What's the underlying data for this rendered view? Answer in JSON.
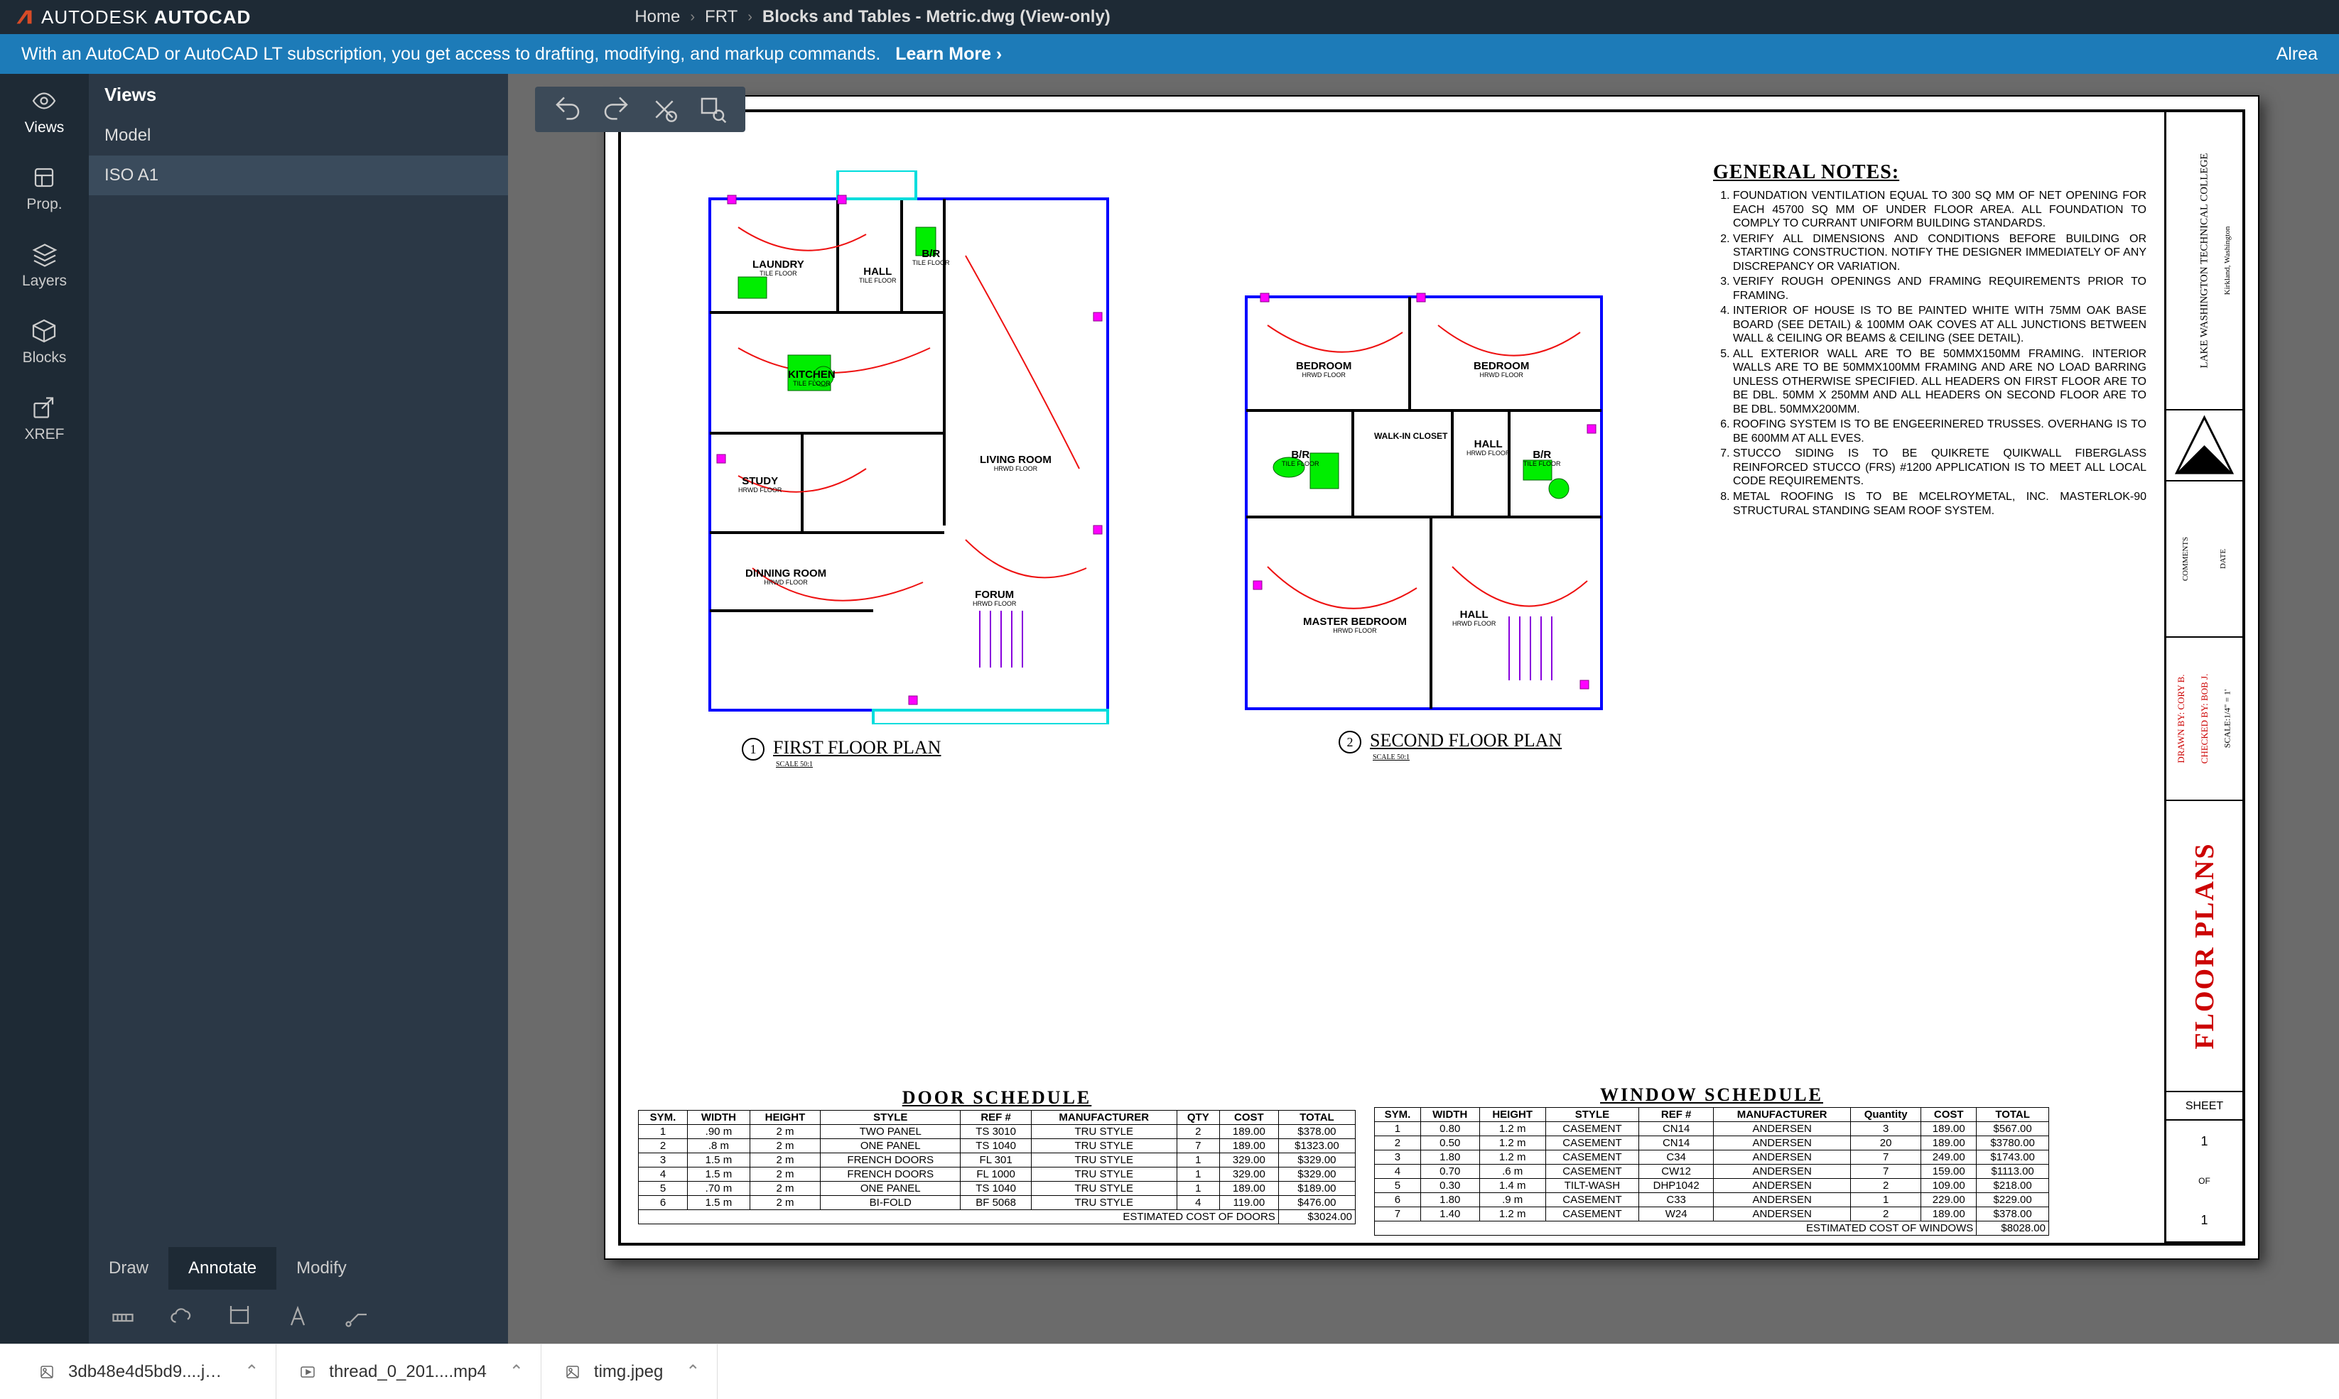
{
  "app": {
    "brand": "AUTODESK",
    "product": "AUTOCAD"
  },
  "breadcrumb": {
    "home": "Home",
    "folder": "FRT",
    "file": "Blocks and Tables - Metric.dwg (View-only)"
  },
  "promo": {
    "text": "With an AutoCAD or AutoCAD LT subscription, you get access to drafting, modifying, and markup commands.",
    "link": "Learn More ›",
    "right": "Alrea"
  },
  "rail": {
    "views": "Views",
    "prop": "Prop.",
    "layers": "Layers",
    "blocks": "Blocks",
    "xref": "XREF"
  },
  "panel": {
    "header": "Views",
    "items": [
      "Model",
      "ISO A1"
    ]
  },
  "bottom_tabs": {
    "draw": "Draw",
    "annotate": "Annotate",
    "modify": "Modify"
  },
  "plans": {
    "first": {
      "title": "FIRST FLOOR PLAN",
      "num": "1",
      "scale": "SCALE  50:1",
      "rooms": {
        "laundry": "LAUNDRY",
        "hall": "HALL",
        "br": "B/R",
        "kitchen": "KITCHEN",
        "living": "LIVING ROOM",
        "study": "STUDY",
        "dining": "DINNING ROOM",
        "forum": "FORUM",
        "tile": "TILE FLOOR",
        "hrwd": "HRWD FLOOR"
      }
    },
    "second": {
      "title": "SECOND FLOOR PLAN",
      "num": "2",
      "scale": "SCALE  50:1",
      "rooms": {
        "bedroom": "BEDROOM",
        "bedroom2": "BEDROOM",
        "walkin": "WALK-IN CLOSET",
        "hall": "HALL",
        "br": "B/R",
        "br2": "B/R",
        "master": "MASTER BEDROOM",
        "hall2": "HALL",
        "tile": "TILE FLOOR",
        "hrwd": "HRWD FLOOR"
      }
    }
  },
  "notes": {
    "title": "GENERAL NOTES:",
    "items": [
      "FOUNDATION VENTILATION EQUAL TO 300 SQ MM OF NET OPENING FOR EACH 45700 SQ MM OF UNDER FLOOR AREA. ALL FOUNDATION TO COMPLY TO CURRANT UNIFORM BUILDING STANDARDS.",
      "VERIFY ALL DIMENSIONS AND CONDITIONS BEFORE BUILDING OR STARTING CONSTRUCTION. NOTIFY THE DESIGNER IMMEDIATELY OF ANY DISCREPANCY OR VARIATION.",
      "VERIFY ROUGH OPENINGS AND FRAMING REQUIREMENTS PRIOR TO FRAMING.",
      "INTERIOR OF HOUSE IS TO BE PAINTED WHITE WITH 75MM OAK  BASE BOARD (SEE DETAIL) & 100MM OAK COVES AT ALL JUNCTIONS BETWEEN WALL & CEILING OR BEAMS & CEILING (SEE DETAIL).",
      "ALL EXTERIOR WALL ARE TO BE 50MMX150MM FRAMING. INTERIOR WALLS ARE TO BE 50MMX100MM FRAMING AND ARE NO LOAD BARRING UNLESS OTHERWISE SPECIFIED. ALL HEADERS ON FIRST FLOOR ARE TO BE DBL. 50MM X 250MM AND ALL HEADERS ON SECOND FLOOR ARE TO BE DBL. 50MMX200MM.",
      "ROOFING SYSTEM IS TO BE ENGEERINERED TRUSSES. OVERHANG IS TO BE 600MM AT ALL EVES.",
      "STUCCO SIDING IS TO BE QUIKRETE QUIKWALL FIBERGLASS REINFORCED STUCCO (FRS) #1200 APPLICATION IS TO MEET ALL LOCAL CODE REQUIREMENTS.",
      "METAL ROOFING IS TO BE MCELROYMETAL, INC. MASTERLOK-90 STRUCTURAL STANDING SEAM ROOF SYSTEM."
    ]
  },
  "door_schedule": {
    "title": "DOOR  SCHEDULE",
    "headers": [
      "SYM.",
      "WIDTH",
      "HEIGHT",
      "STYLE",
      "REF #",
      "MANUFACTURER",
      "QTY",
      "COST",
      "TOTAL"
    ],
    "rows": [
      [
        "1",
        ".90 m",
        "2 m",
        "TWO PANEL",
        "TS 3010",
        "TRU STYLE",
        "2",
        "189.00",
        "$378.00"
      ],
      [
        "2",
        ".8 m",
        "2 m",
        "ONE PANEL",
        "TS 1040",
        "TRU STYLE",
        "7",
        "189.00",
        "$1323.00"
      ],
      [
        "3",
        "1.5 m",
        "2 m",
        "FRENCH DOORS",
        "FL 301",
        "TRU STYLE",
        "1",
        "329.00",
        "$329.00"
      ],
      [
        "4",
        "1.5 m",
        "2 m",
        "FRENCH DOORS",
        "FL 1000",
        "TRU STYLE",
        "1",
        "329.00",
        "$329.00"
      ],
      [
        "5",
        ".70 m",
        "2 m",
        "ONE PANEL",
        "TS 1040",
        "TRU STYLE",
        "1",
        "189.00",
        "$189.00"
      ],
      [
        "6",
        "1.5 m",
        "2 m",
        "BI-FOLD",
        "BF 5068",
        "TRU STYLE",
        "4",
        "119.00",
        "$476.00"
      ]
    ],
    "footer": {
      "label": "ESTIMATED COST OF DOORS",
      "total": "$3024.00"
    }
  },
  "window_schedule": {
    "title": "WINDOW  SCHEDULE",
    "headers": [
      "SYM.",
      "WIDTH",
      "HEIGHT",
      "STYLE",
      "REF #",
      "MANUFACTURER",
      "Quantity",
      "COST",
      "TOTAL"
    ],
    "rows": [
      [
        "1",
        "0.80",
        "1.2 m",
        "CASEMENT",
        "CN14",
        "ANDERSEN",
        "3",
        "189.00",
        "$567.00"
      ],
      [
        "2",
        "0.50",
        "1.2 m",
        "CASEMENT",
        "CN14",
        "ANDERSEN",
        "20",
        "189.00",
        "$3780.00"
      ],
      [
        "3",
        "1.80",
        "1.2 m",
        "CASEMENT",
        "C34",
        "ANDERSEN",
        "7",
        "249.00",
        "$1743.00"
      ],
      [
        "4",
        "0.70",
        ".6 m",
        "CASEMENT",
        "CW12",
        "ANDERSEN",
        "7",
        "159.00",
        "$1113.00"
      ],
      [
        "5",
        "0.30",
        "1.4 m",
        "TILT-WASH",
        "DHP1042",
        "ANDERSEN",
        "2",
        "109.00",
        "$218.00"
      ],
      [
        "6",
        "1.80",
        ".9 m",
        "CASEMENT",
        "C33",
        "ANDERSEN",
        "1",
        "229.00",
        "$229.00"
      ],
      [
        "7",
        "1.40",
        "1.2 m",
        "CASEMENT",
        "W24",
        "ANDERSEN",
        "2",
        "189.00",
        "$378.00"
      ]
    ],
    "footer": {
      "label": "ESTIMATED COST OF WINDOWS",
      "total": "$8028.00"
    }
  },
  "title_block": {
    "college": "LAKE WASHINGTON TECHNICAL COLLEGE",
    "city": "Kirkland, Washington",
    "comments": "COMMENTS",
    "date": "DATE",
    "drawn": "DRAWN BY: CORY B.",
    "checked": "CHECKED BY: BOB J.",
    "scale": "SCALE:1/4\" = 1'",
    "big": "FLOOR PLANS",
    "sheet": "SHEET",
    "of": "OF",
    "n1": "1",
    "n2": "1"
  },
  "taskbar": {
    "f1": "3db48e4d5bd9....j…",
    "f2": "thread_0_201....mp4",
    "f3": "timg.jpeg"
  }
}
